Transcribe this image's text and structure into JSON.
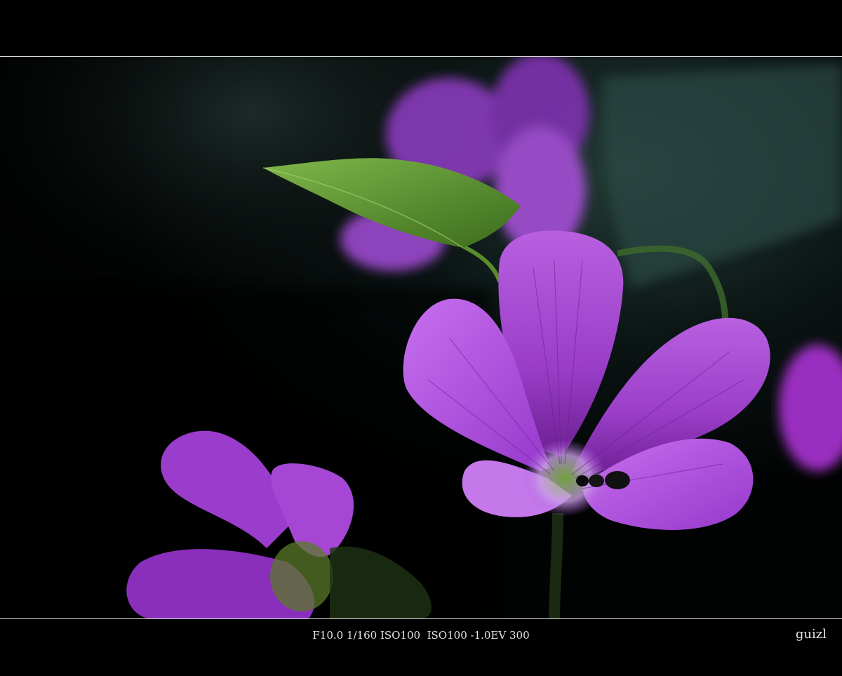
{
  "caption": {
    "exif": "F10.0 1/160 ISO100  ISO100 -1.0EV 300",
    "author": "guizl"
  },
  "photo": {
    "subject": "purple flowers",
    "colors": {
      "background": "#020403",
      "petal": "#b24fd8",
      "petal_light": "#e39cf5",
      "leaf": "#5e9a2a"
    }
  }
}
